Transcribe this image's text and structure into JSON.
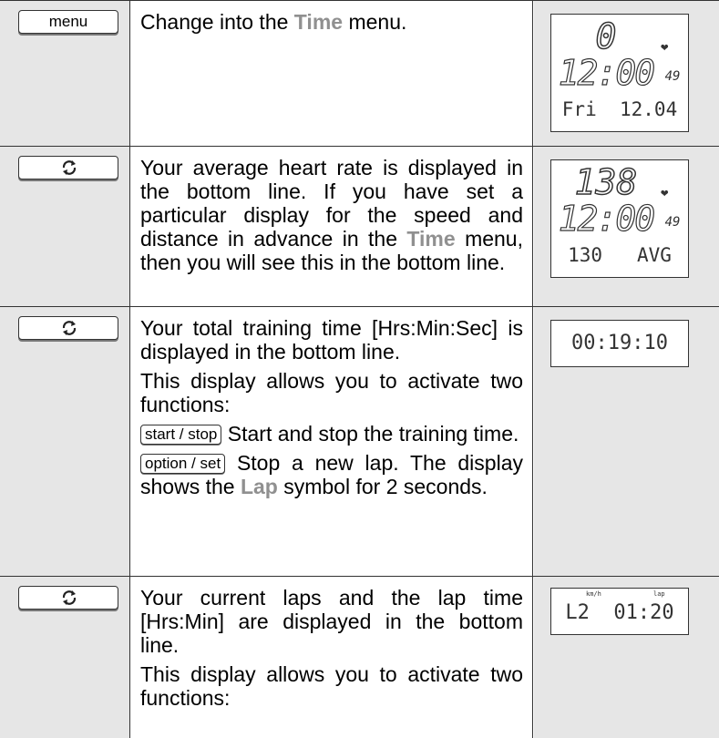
{
  "rows": [
    {
      "button": {
        "type": "label",
        "label": "menu"
      },
      "text": [
        {
          "pre": "Change into the ",
          "hl": "Time",
          "post": " menu."
        }
      ],
      "display": {
        "top": "0",
        "mid": "12:00",
        "mid_small": "49",
        "bottom": "Fri  12.04"
      }
    },
    {
      "button": {
        "type": "icon",
        "icon": "cycle-arrows-icon"
      },
      "text": [
        {
          "pre": "Your average heart rate is displayed in the bottom line. If you have set a particular display for the speed and distance in advance in the ",
          "hl": "Time",
          "post": " menu, then you will see this in the bottom line."
        }
      ],
      "display": {
        "top": "138",
        "mid": "12:00",
        "mid_small": "49",
        "bottom": "130   AVG"
      }
    },
    {
      "button": {
        "type": "icon",
        "icon": "cycle-arrows-icon"
      },
      "text": [
        {
          "pre": "Your total training time [Hrs:Min:Sec] is displayed in the bottom line."
        },
        {
          "pre": "This display allows you to activate two functions:"
        },
        {
          "btn": "start / stop",
          "pre": " Start and stop the training time."
        },
        {
          "btn": "option / set",
          "pre": " Stop a new lap. The display shows the ",
          "hl": "Lap",
          "post": " symbol for 2 seconds."
        }
      ],
      "display": {
        "line": "00:19:10"
      }
    },
    {
      "button": {
        "type": "icon",
        "icon": "cycle-arrows-icon"
      },
      "text": [
        {
          "pre": "Your current laps and the lap time [Hrs:Min] are displayed in the bottom line."
        },
        {
          "pre": "This display allows you to activate two functions:"
        }
      ],
      "display": {
        "small_left": "km/h",
        "small_right": "lap",
        "line": "L2  01:20"
      }
    }
  ]
}
